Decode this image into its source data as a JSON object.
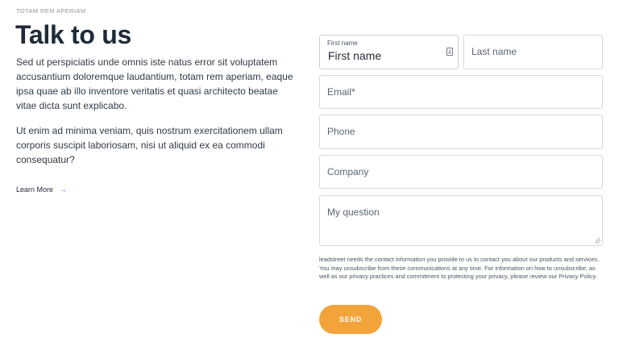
{
  "intro": {
    "eyebrow": "TOTAM REM APERIAM",
    "title": "Talk to us",
    "paragraph1": "Sed ut perspiciatis unde omnis iste natus error sit voluptatem accusantium doloremque laudantium, totam rem aperiam, eaque ipsa quae ab illo inventore veritatis et quasi architecto beatae vitae dicta sunt explicabo.",
    "paragraph2": "Ut enim ad minima veniam, quis nostrum exercitationem ullam corporis suscipit laboriosam, nisi ut aliquid ex ea commodi consequatur?",
    "learn_more": "Learn More",
    "learn_more_arrow": "→"
  },
  "form": {
    "first_name": {
      "label": "First name",
      "value": "First name"
    },
    "last_name": {
      "placeholder": "Last name"
    },
    "email": {
      "placeholder": "Email*"
    },
    "phone": {
      "placeholder": "Phone"
    },
    "company": {
      "placeholder": "Company"
    },
    "question": {
      "placeholder": "My question"
    },
    "privacy_text": "leadstreet needs the contact information you provide to us to contact you about our products and services. You may unsubscribe from these communications at any time. For information on how to unsubscribe, as well as our privacy practices and commitment to protecting your privacy, please review our Privacy Policy.",
    "send_label": "SEND"
  },
  "colors": {
    "accent": "#f2a33a",
    "link_arrow": "#3b7dd8",
    "heading": "#1e2a38"
  }
}
